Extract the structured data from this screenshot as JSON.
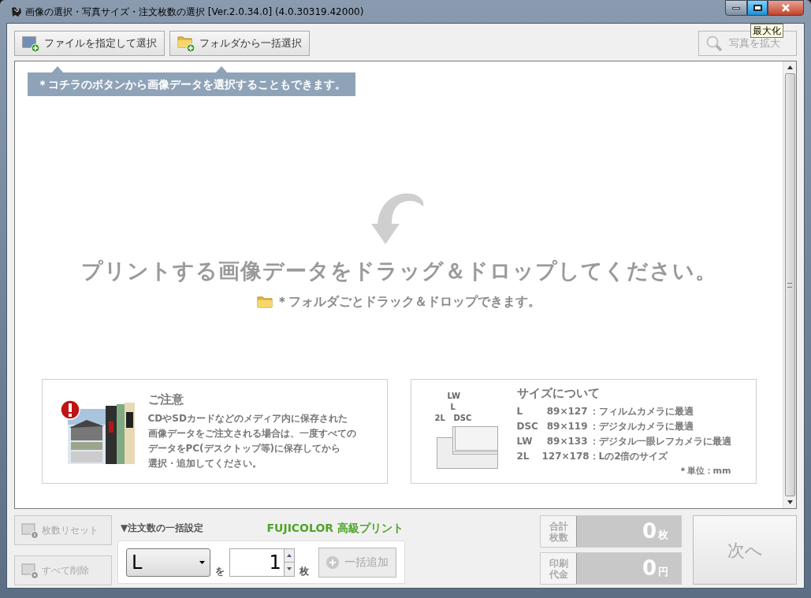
{
  "window": {
    "title": "画像の選択・写真サイズ・注文枚数の選択 [Ver.2.0.34.0] (4.0.30319.42000)",
    "tooltip": "最大化"
  },
  "toolbar": {
    "buttons": [
      {
        "label": "ファイルを指定して選択",
        "kind": "file"
      },
      {
        "label": "フォルダから一括選択",
        "kind": "folder"
      }
    ],
    "zoom_button": {
      "label": "写真を拡大",
      "disabled": true
    }
  },
  "hint": "＊コチラのボタンから画像データを選択することもできます。",
  "drop_area": {
    "message": "プリントする画像データをドラッグ＆ドロップしてください。",
    "sub_message": "＊フォルダごとドラック＆ドロップできます。"
  },
  "notice": {
    "title": "ご注意",
    "lines": [
      "CDやSDカードなどのメディア内に保存された",
      "画像データをご注文される場合は、一度すべての",
      "データをPC(デスクトップ等)に保存してから",
      "選択・追加してください。"
    ]
  },
  "sizes": {
    "title": "サイズについて",
    "diagram_labels": [
      "LW",
      "L",
      "2L",
      "DSC"
    ],
    "rows": [
      {
        "name": "L",
        "dims": "89×127",
        "note": "：フィルムカメラに最適"
      },
      {
        "name": "DSC",
        "dims": "89×119",
        "note": "：デジタルカメラに最適"
      },
      {
        "name": "LW",
        "dims": "89×133",
        "note": "：デジタル一眼レフカメラに最適"
      },
      {
        "name": "2L",
        "dims": "127×178",
        "note": "：Lの2倍のサイズ"
      }
    ],
    "unit": "＊単位：mm"
  },
  "side_buttons": [
    {
      "label": "枚数リセット",
      "kind": "reset",
      "disabled": true
    },
    {
      "label": "すべて削除",
      "kind": "delete",
      "disabled": true
    }
  ],
  "bulk": {
    "title": "▼注文数の一括設定",
    "brand": "FUJICOLOR 高級プリント",
    "size": "L",
    "particle": "を",
    "count": "1",
    "unit": "枚",
    "add_button": {
      "label": "一括追加",
      "disabled": true
    }
  },
  "totals": [
    {
      "label": [
        "合計",
        "枚数"
      ],
      "value": "0",
      "unit": "枚"
    },
    {
      "label": [
        "印刷",
        "代金"
      ],
      "value": "0",
      "unit": "円"
    }
  ],
  "next_button": {
    "label": "次へ",
    "disabled": true
  }
}
